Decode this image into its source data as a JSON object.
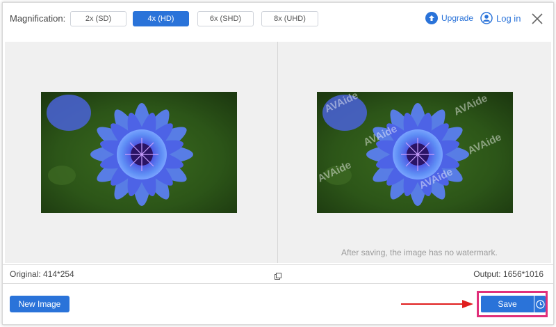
{
  "toolbar": {
    "magnification_label": "Magnification:",
    "options": [
      {
        "label": "2x (SD)",
        "active": false
      },
      {
        "label": "4x (HD)",
        "active": true
      },
      {
        "label": "6x (SHD)",
        "active": false
      },
      {
        "label": "8x (UHD)",
        "active": false
      }
    ],
    "upgrade_label": "Upgrade",
    "login_label": "Log in"
  },
  "preview": {
    "watermark_text": "AVAide",
    "note": "After saving, the image has no watermark."
  },
  "info": {
    "original": "Original: 414*254",
    "output": "Output: 1656*1016"
  },
  "actions": {
    "new_image_label": "New Image",
    "save_label": "Save"
  },
  "colors": {
    "accent": "#2a73d9",
    "highlight": "#e0307a",
    "arrow": "#e01e1e"
  }
}
